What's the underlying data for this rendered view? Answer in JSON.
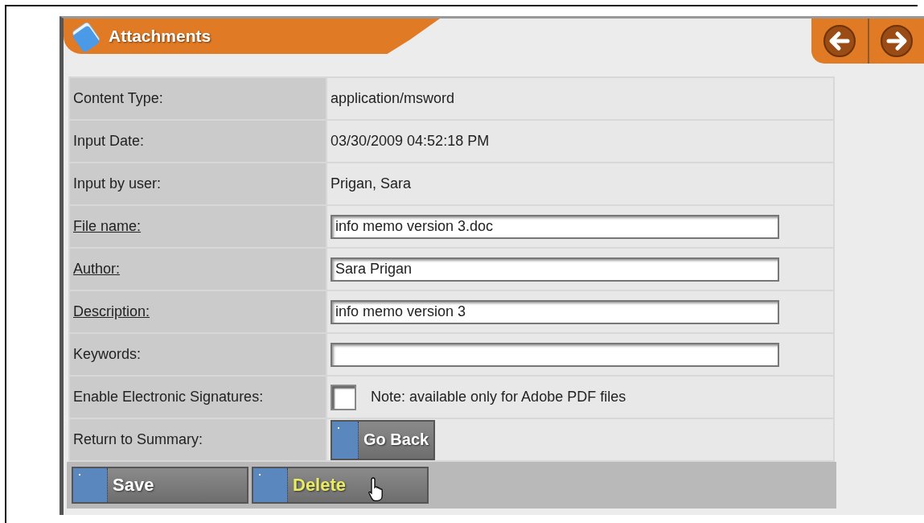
{
  "header": {
    "title": "Attachments"
  },
  "rows": [
    {
      "kind": "text",
      "label": "Content Type:",
      "underlined": false,
      "value": "application/msword"
    },
    {
      "kind": "text",
      "label": "Input Date:",
      "underlined": false,
      "value": "03/30/2009 04:52:18 PM"
    },
    {
      "kind": "text",
      "label": "Input by user:",
      "underlined": false,
      "value": "Prigan, Sara"
    },
    {
      "kind": "input",
      "label": "File name:",
      "underlined": true,
      "value": "info memo version 3.doc"
    },
    {
      "kind": "input",
      "label": "Author:",
      "underlined": true,
      "value": "Sara Prigan"
    },
    {
      "kind": "input",
      "label": "Description:",
      "underlined": true,
      "value": "info memo version 3"
    },
    {
      "kind": "input",
      "label": "Keywords:",
      "underlined": false,
      "value": ""
    },
    {
      "kind": "checkbox",
      "label": "Enable Electronic Signatures:",
      "underlined": false,
      "checked": false,
      "note": "Note: available only for Adobe PDF files"
    },
    {
      "kind": "button",
      "label": "Return to Summary:",
      "underlined": false,
      "button": "Go Back"
    }
  ],
  "buttons": [
    {
      "label": "Save",
      "hovered": false
    },
    {
      "label": "Delete",
      "hovered": true
    }
  ]
}
